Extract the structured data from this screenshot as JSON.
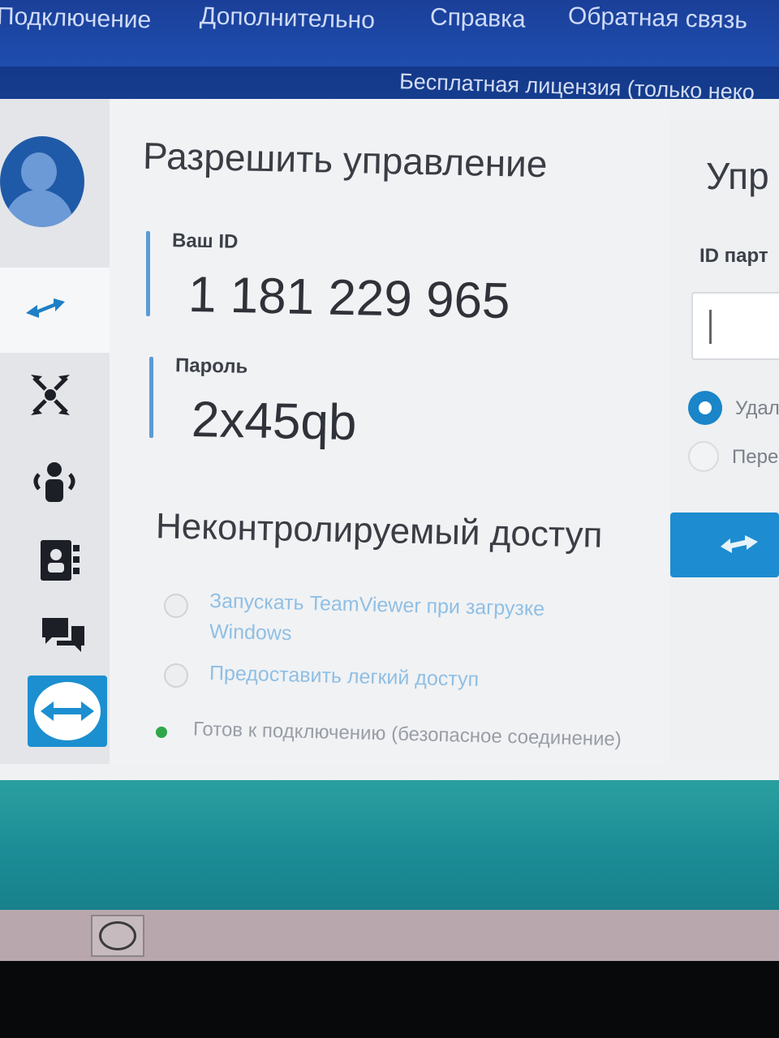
{
  "menu": {
    "items": [
      "Подключение",
      "Дополнительно",
      "Справка",
      "Обратная связь"
    ]
  },
  "license_banner": "Бесплатная лицензия (только неко",
  "allow_control": {
    "title": "Разрешить управление",
    "your_id_label": "Ваш ID",
    "your_id_value": "1 181 229 965",
    "password_label": "Пароль",
    "password_value": "2x45qb"
  },
  "unattended_access": {
    "title": "Неконтролируемый доступ",
    "option_start_line1": "Запускать TeamViewer при загрузке",
    "option_start_line2": "Windows",
    "option_easy_access": "Предоставить легкий доступ"
  },
  "status": {
    "text": "Готов к подключению (безопасное соединение)",
    "color": "#2ea84a"
  },
  "control_remote": {
    "title": "Упр",
    "partner_id_label": "ID парт",
    "radio_remote": "Удал",
    "radio_transfer": "Пере"
  },
  "sidebar_icons": [
    "user-avatar-icon",
    "remote-control-icon",
    "meeting-icon",
    "contacts-icon",
    "computers-contacts-icon",
    "chat-icon",
    "teamviewer-logo-icon"
  ],
  "colors": {
    "accent": "#1d8cd0",
    "menubar": "#1f4eb0",
    "desktop": "#1c8d96"
  }
}
